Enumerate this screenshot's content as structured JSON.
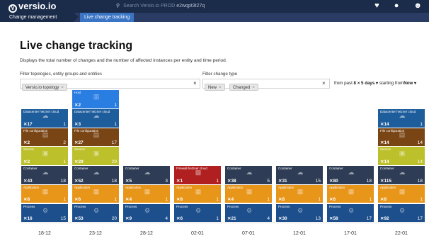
{
  "app": {
    "name": "versio.io",
    "logo_glyph": "V"
  },
  "search": {
    "placeholder": "Search Versio.io PROD",
    "instance": "e2wqpt3t27q"
  },
  "top_icons": [
    "heart-monitor-icon",
    "chat-icon",
    "user-icon"
  ],
  "breadcrumbs": [
    "Change management",
    "Live change tracking"
  ],
  "page": {
    "title": "Live change tracking",
    "description": "Displays the total number of changes and the number of affected instances per entity and time period."
  },
  "filters": {
    "topology_label": "Filter topologies, entity groups and entities",
    "topology_tags": [
      "Versio.io topology"
    ],
    "change_label": "Filter change type",
    "change_tags": [
      "New",
      "Changed"
    ],
    "tag_remove": "×",
    "clear": "×"
  },
  "range": {
    "prefix": "from past",
    "amount": "8",
    "unit": "5 days",
    "starting": "starting from",
    "start": "Now"
  },
  "colors": {
    "Process": "#1d4f8c",
    "Application": "#e8961a",
    "Container": "#2e3d55",
    "Service": "#bcc02a",
    "File configuration": "#7a4515",
    "Datacenter hetzner cloud": "#1e5d9c",
    "Host": "#2a7de1",
    "Firewall hetzner cloud": "#b02020"
  },
  "chart_data": {
    "type": "stacked-blocks",
    "dates": [
      "18-12",
      "23-12",
      "28-12",
      "02-01",
      "07-01",
      "12-01",
      "17-01",
      "22-01"
    ],
    "columns": [
      {
        "date": "18-12",
        "blocks": [
          {
            "entity": "Process",
            "changes": 16,
            "instances": 15
          },
          {
            "entity": "Application",
            "changes": 8,
            "instances": 1
          },
          {
            "entity": "Container",
            "changes": 43,
            "instances": 18
          },
          {
            "entity": "Service",
            "changes": 2,
            "instances": 1
          },
          {
            "entity": "File configuration",
            "changes": 2,
            "instances": 2
          },
          {
            "entity": "Datacenter hetzner cloud",
            "changes": 17,
            "instances": 1
          }
        ]
      },
      {
        "date": "23-12",
        "blocks": [
          {
            "entity": "Process",
            "changes": 53,
            "instances": 20
          },
          {
            "entity": "Application",
            "changes": 6,
            "instances": 1
          },
          {
            "entity": "Container",
            "changes": 52,
            "instances": 18
          },
          {
            "entity": "Service",
            "changes": 29,
            "instances": 29
          },
          {
            "entity": "File configuration",
            "changes": 27,
            "instances": 17
          },
          {
            "entity": "Datacenter hetzner cloud",
            "changes": 3,
            "instances": 1
          },
          {
            "entity": "Host",
            "changes": 2,
            "instances": 1
          }
        ]
      },
      {
        "date": "28-12",
        "blocks": [
          {
            "entity": "Process",
            "changes": 9,
            "instances": 4
          },
          {
            "entity": "Application",
            "changes": 4,
            "instances": 1
          },
          {
            "entity": "Container",
            "changes": 5,
            "instances": 3
          }
        ]
      },
      {
        "date": "02-01",
        "blocks": [
          {
            "entity": "Process",
            "changes": 6,
            "instances": 1
          },
          {
            "entity": "Application",
            "changes": 8,
            "instances": 1
          },
          {
            "entity": "Firewall hetzner cloud",
            "changes": 1,
            "instances": 1
          }
        ]
      },
      {
        "date": "07-01",
        "blocks": [
          {
            "entity": "Process",
            "changes": 21,
            "instances": 4
          },
          {
            "entity": "Application",
            "changes": 4,
            "instances": 1
          },
          {
            "entity": "Container",
            "changes": 38,
            "instances": 5
          }
        ]
      },
      {
        "date": "12-01",
        "blocks": [
          {
            "entity": "Process",
            "changes": 30,
            "instances": 13
          },
          {
            "entity": "Application",
            "changes": 8,
            "instances": 1
          },
          {
            "entity": "Container",
            "changes": 31,
            "instances": 15
          }
        ]
      },
      {
        "date": "17-01",
        "blocks": [
          {
            "entity": "Process",
            "changes": 58,
            "instances": 17
          },
          {
            "entity": "Application",
            "changes": 6,
            "instances": 1
          },
          {
            "entity": "Container",
            "changes": 80,
            "instances": 18
          }
        ]
      },
      {
        "date": "22-01",
        "blocks": [
          {
            "entity": "Process",
            "changes": 92,
            "instances": 17
          },
          {
            "entity": "Application",
            "changes": 8,
            "instances": 1
          },
          {
            "entity": "Container",
            "changes": 115,
            "instances": 18
          },
          {
            "entity": "Service",
            "changes": 14,
            "instances": 14
          },
          {
            "entity": "File configuration",
            "changes": 14,
            "instances": 14
          },
          {
            "entity": "Datacenter hetzner cloud",
            "changes": 14,
            "instances": 1
          }
        ]
      }
    ]
  }
}
